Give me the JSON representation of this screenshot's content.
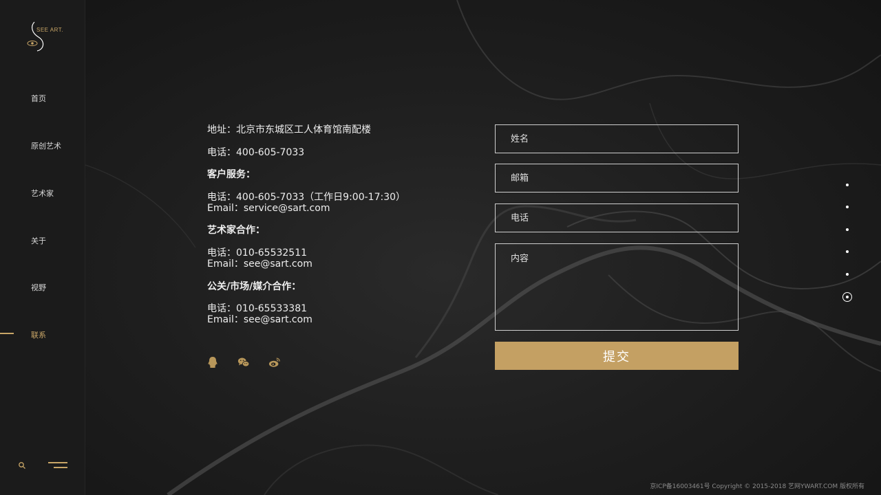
{
  "brand": {
    "logo_text": "SEE ART.",
    "accent": "#c9a667"
  },
  "sidebar": {
    "items": [
      {
        "label": "首页",
        "active": false
      },
      {
        "label": "原创艺术",
        "active": false
      },
      {
        "label": "艺术家",
        "active": false
      },
      {
        "label": "关于",
        "active": false
      },
      {
        "label": "视野",
        "active": false
      },
      {
        "label": "联系",
        "active": true
      }
    ],
    "search_icon": "search-icon",
    "menu_icon": "menu-icon"
  },
  "contact": {
    "address": "地址：北京市东城区工人体育馆南配楼",
    "phone": "电话：400-605-7033",
    "customer_service": {
      "heading": "客户服务：",
      "phone": "电话：400-605-7033（工作日9:00-17:30）",
      "email": "Email：service@sart.com"
    },
    "artist_cooperation": {
      "heading": "艺术家合作：",
      "phone": "电话：010-65532511",
      "email": "Email：see@sart.com"
    },
    "media_cooperation": {
      "heading": "公关/市场/媒介合作：",
      "phone": "电话：010-65533381",
      "email": "Email：see@sart.com"
    },
    "social": [
      "qq-icon",
      "wechat-icon",
      "weibo-icon"
    ]
  },
  "form": {
    "name_placeholder": "姓名",
    "email_placeholder": "邮箱",
    "phone_placeholder": "电话",
    "content_placeholder": "内容",
    "submit_label": "提交"
  },
  "pager": {
    "total": 6,
    "active_index": 5
  },
  "footer": {
    "copyright": "京ICP备16003461号 Copyright © 2015-2018 艺网YWART.COM 版权所有"
  }
}
